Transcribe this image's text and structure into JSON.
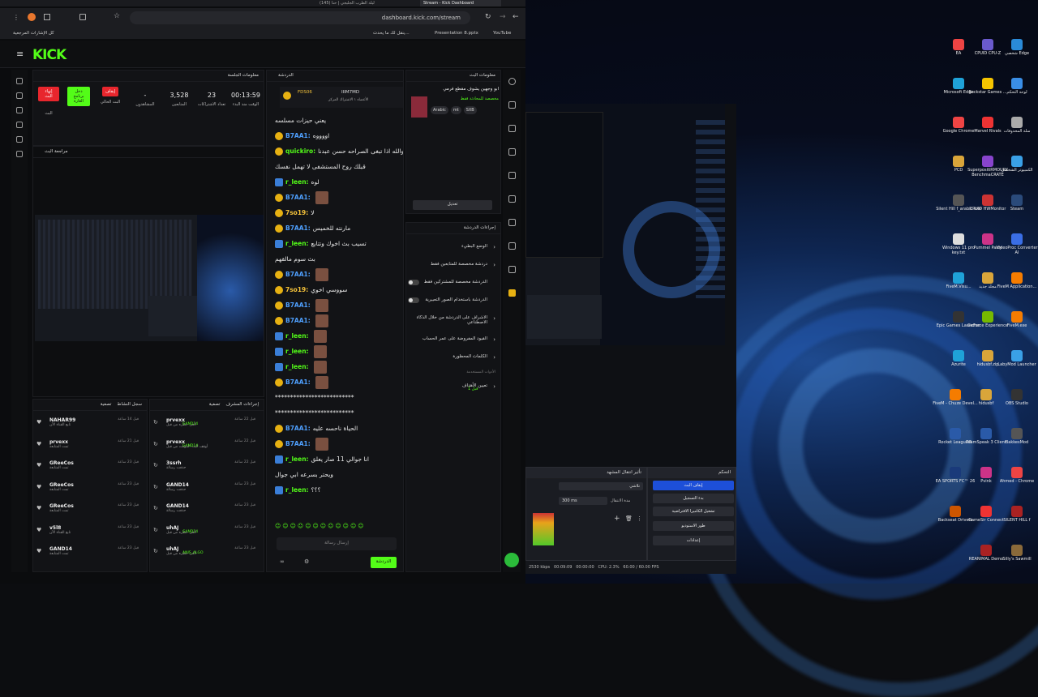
{
  "browser": {
    "tabs": [
      {
        "label": "(145) ليلة الطرب الجليجي | حنا"
      },
      {
        "label": "Stream - Kick Dashboard"
      }
    ],
    "url": "dashboard.kick.com/stream",
    "bookmarks": {
      "all": "كل الإشارات المرجعية",
      "items": [
        "YouTube",
        "Presentation 8.pptx",
        "ينقل لك ما يحدث..."
      ]
    }
  },
  "kick": {
    "logo": "KICK",
    "stream_info": {
      "title": "معلومات الجلسة",
      "end_btn": "إنهاء البث",
      "go_btn": "دخل برنامج الغارة",
      "pause_btn": "إيقاف",
      "stats": [
        {
          "value": "-",
          "label": "المشاهدون"
        },
        {
          "value": "3,528",
          "label": "المتابعين"
        },
        {
          "value": "23",
          "label": "تعداد الاشتراكات"
        },
        {
          "value": "00:13:59",
          "label": "الوقت منذ البدء"
        }
      ],
      "labels": [
        "البث الحالي",
        "البث"
      ]
    },
    "preview": {
      "title": "مراجعة البث"
    },
    "chat": {
      "title": "الدردشة",
      "pinned_user": "FDS06",
      "pinned_user2": "IIIM7MD",
      "pinned_text": "الأعضاء ١ الاشتراك المركز",
      "lines": [
        {
          "user": "",
          "text": "يعني حيزات مسلسه"
        },
        {
          "user": "B7AA1:",
          "text": "اووووه"
        },
        {
          "user": "quickiro:",
          "text": "والله اذا تبغى الصراحه حسن عبدنا"
        },
        {
          "user": "",
          "text": "قبلك روح المستشفى لا تهمل نفسك"
        },
        {
          "user": "r_leen:",
          "text": "لوه"
        },
        {
          "user": "B7AA1:",
          "text": ""
        },
        {
          "user": "7so19:",
          "text": "لا"
        },
        {
          "user": "B7AA1:",
          "text": "مارنته للخميس"
        },
        {
          "user": "r_leen:",
          "text": "تسيب بث اخوك وتتابع"
        },
        {
          "user": "",
          "text": "بث سوم مالقهم"
        },
        {
          "user": "B7AA1:",
          "text": ""
        },
        {
          "user": "7so19:",
          "text": "سووسي اخوي"
        },
        {
          "user": "B7AA1:",
          "text": ""
        },
        {
          "user": "B7AA1:",
          "text": ""
        },
        {
          "user": "r_leen:",
          "text": ""
        },
        {
          "user": "r_leen:",
          "text": ""
        },
        {
          "user": "r_leen:",
          "text": ""
        },
        {
          "user": "B7AA1:",
          "text": ""
        },
        {
          "user": "",
          "text": "**************************"
        },
        {
          "user": "",
          "text": "**************************"
        },
        {
          "user": "B7AA1:",
          "text": "الحياة ناحسه عليه"
        },
        {
          "user": "B7AA1:",
          "text": ""
        },
        {
          "user": "r_leen:",
          "text": "انا جوالي 11 صار يعلق"
        },
        {
          "user": "",
          "text": "ويحتر بسرعه ابي جوال"
        },
        {
          "user": "r_leen:",
          "text": "؟؟؟"
        }
      ],
      "input_placeholder": "إرسال رسالة",
      "send_btn": "الدردشة"
    },
    "stream_meta": {
      "title": "معلومات البث",
      "stream_title": "ابو وجهين يشوف مقطع فرمي",
      "category": "مخصصة للمحادثة فقط",
      "tags": [
        "Arabic",
        "mt",
        "SXB"
      ],
      "edit_btn": "تعديل"
    },
    "chat_actions": {
      "title": "إجراءات الدردشة",
      "items": [
        {
          "label": "الوضع البطيء"
        },
        {
          "label": "دردشة مخصصة للمتابعين فقط"
        },
        {
          "label": "الدردشة مخصصة للمشتركين فقط"
        },
        {
          "label": "الدردشة باستخدام الصور التعبيرية"
        },
        {
          "label": "الاشراف على الدردشة من خلال الذكاء الاصطناعي"
        },
        {
          "label": "القيود المفروضة على عمر الحساب"
        },
        {
          "label": "الكلمات المحظورة"
        },
        {
          "label": "تعيين الأهداف"
        }
      ],
      "subtitle": "الأدوات المستخدمة",
      "goal_status": "1 قبل"
    },
    "recent_activity": {
      "title": "سجل النشاط",
      "filter": "تصفية",
      "items": [
        {
          "name": "NAHAR99",
          "sub": "تابع القناة الآن",
          "time": "قبل 14 ساعة"
        },
        {
          "name": "prvexx",
          "sub": "تمت المتابعة",
          "time": "قبل 21 ساعة"
        },
        {
          "name": "GReeCos",
          "sub": "تمت المتابعة",
          "time": "قبل 23 ساعة"
        },
        {
          "name": "GReeCos",
          "sub": "تمت المتابعة",
          "time": "قبل 23 ساعة"
        },
        {
          "name": "GReeCos",
          "sub": "تمت المتابعة",
          "time": "قبل 23 ساعة"
        },
        {
          "name": "v5l8",
          "sub": "تابع القناة الآن",
          "time": "قبل 23 ساعة"
        },
        {
          "name": "GAND14",
          "sub": "تمت المتابعة",
          "time": "قبل 23 ساعة"
        }
      ]
    },
    "mod_actions": {
      "title": "إجراءات المشرف",
      "filter": "تصفية",
      "items": [
        {
          "name": "prvexx",
          "sub": "ألغى حظره من قبل",
          "target": "GAND14",
          "time": "قبل 22 ساعة"
        },
        {
          "name": "prvexx",
          "sub": "أوقف البث المؤقت من قبل",
          "target": "GAND14",
          "time": "قبل 22 ساعة"
        },
        {
          "name": "3ssrh",
          "sub": "حذفت رسالة",
          "target": "",
          "time": "قبل 22 ساعة"
        },
        {
          "name": "GAND14",
          "sub": "حذفت رسالة",
          "target": "",
          "time": "قبل 23 ساعة"
        },
        {
          "name": "GAND14",
          "sub": "حذفت رسالة",
          "target": "",
          "time": "قبل 23 ساعة"
        },
        {
          "name": "uhAJ",
          "sub": "ألغى حظره من قبل",
          "target": "GAND14",
          "time": "قبل 23 ساعة"
        },
        {
          "name": "uhAJ",
          "sub": "ألغى حظره من قبل",
          "target": "ANIS_ALGO",
          "time": "قبل 23 ساعة"
        }
      ]
    }
  },
  "obs": {
    "dock_controls": {
      "title": "التحكم",
      "buttons": [
        "إيقاف البث",
        "بدء التسجيل",
        "تشغيل الكاميرا الافتراضية",
        "طور الاستوديو",
        "إعدادات"
      ]
    },
    "dock_transitions": {
      "title": "تأثير انتقال المشهد",
      "fade": "تلاشي",
      "duration_label": "مدة الانتقال",
      "duration": "300 ms"
    },
    "status": {
      "bitrate": "2530 kbps",
      "time1": "00:09:09",
      "time2": "00:00:00",
      "cpu": "CPU: 2.3%",
      "fps": "60.00 / 60.00 FPS"
    }
  },
  "desktop_icons": [
    {
      "label": "شخصي Edge",
      "color": "#2a8ad8"
    },
    {
      "label": "CPUID CPU-Z",
      "color": "#6a5acd"
    },
    {
      "label": "EA",
      "color": "#e44"
    },
    {
      "label": "لوحة التحكم",
      "color": "#3a8ee6"
    },
    {
      "label": "Rockstar Games ...",
      "color": "#f5c400"
    },
    {
      "label": "Microsoft Edge",
      "color": "#1fa2d8"
    },
    {
      "label": "سلة المحذوفات",
      "color": "#aaa"
    },
    {
      "label": "Marvel Rivals",
      "color": "#e33"
    },
    {
      "label": "Google Chrome",
      "color": "#e44"
    },
    {
      "label": "الكمبيوتر الشخصي",
      "color": "#3aa0e6"
    },
    {
      "label": "SuperpositiRMOURY BenchmaCRATE",
      "color": "#8844cc"
    },
    {
      "label": "PCD",
      "color": "#d9a53a"
    },
    {
      "label": "Steam",
      "color": "#2a4a7a"
    },
    {
      "label": "CPUID HWMonitor",
      "color": "#c33"
    },
    {
      "label": "Silent Hill f_arabic.exe",
      "color": "#555"
    },
    {
      "label": "VideoProc Converter AI",
      "color": "#3a6ee6"
    },
    {
      "label": "Pummel Party",
      "color": "#cc3388"
    },
    {
      "label": "Windows 11 pro key.txt",
      "color": "#ddd"
    },
    {
      "label": "FiveM Application...",
      "color": "#f57c00"
    },
    {
      "label": "مجلد جديد",
      "color": "#d9a53a"
    },
    {
      "label": "FiveM.Visu...",
      "color": "#1fa2d8"
    },
    {
      "label": "FiveM.exe",
      "color": "#f57c00"
    },
    {
      "label": "GeForce Experience",
      "color": "#76b900"
    },
    {
      "label": "Epic Games Launcher",
      "color": "#333"
    },
    {
      "label": "LabyMod Launcher",
      "color": "#3aa0e6"
    },
    {
      "label": "hidusbf.zip",
      "color": "#d9a53a"
    },
    {
      "label": "Azurite",
      "color": "#1fa2d8"
    },
    {
      "label": "OBS Studio",
      "color": "#333"
    },
    {
      "label": "hidusbf",
      "color": "#d9a53a"
    },
    {
      "label": "FiveM - Chuze Devel...",
      "color": "#f57c00"
    },
    {
      "label": "BakkesMod",
      "color": "#555"
    },
    {
      "label": "TeamSpeak 3 Client",
      "color": "#2a5aa8"
    },
    {
      "label": "Rocket League®",
      "color": "#2a5aa8"
    },
    {
      "label": "Ahmed - Chrome",
      "color": "#e44"
    },
    {
      "label": "Pvink",
      "color": "#cc3388"
    },
    {
      "label": "EA SPORTS FC™ 26",
      "color": "#1a3a7a"
    },
    {
      "label": "SILENT HILL f",
      "color": "#aa2222"
    },
    {
      "label": "GameSir Connect",
      "color": "#e33"
    },
    {
      "label": "Backseat Drivers",
      "color": "#cc5500"
    },
    {
      "label": "Silly's Sawmill",
      "color": "#8a6a3a"
    },
    {
      "label": "REANIMAL Demo",
      "color": "#aa2222"
    }
  ],
  "colors": {
    "kick_green": "#53fc18",
    "live_red": "#e8262d"
  }
}
